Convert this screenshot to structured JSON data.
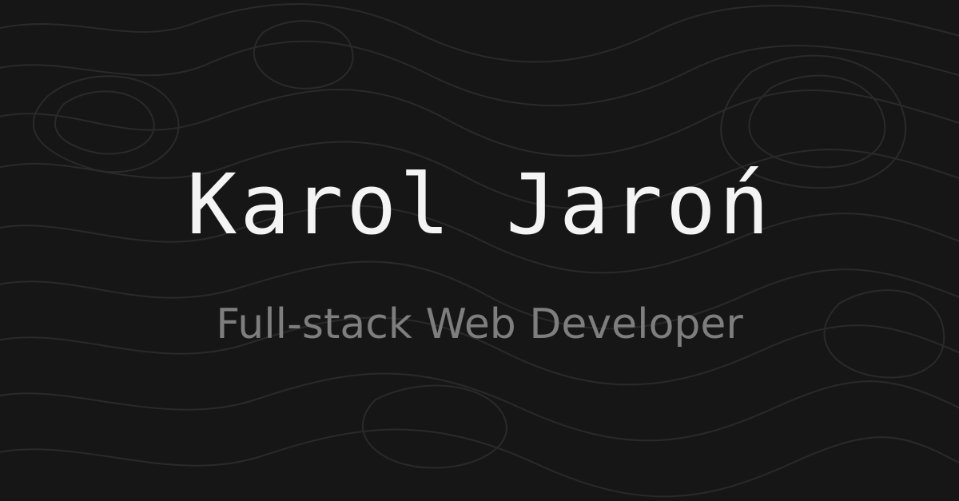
{
  "colors": {
    "background": "#161616",
    "contour_lines": "#2a2a2a",
    "name_text": "#f4f4f4",
    "role_text": "#7e7e7e"
  },
  "header": {
    "name": "Karol Jaroń",
    "role": "Full-stack Web Developer"
  },
  "decor": {
    "background_pattern": "topographic-contour-pattern"
  }
}
